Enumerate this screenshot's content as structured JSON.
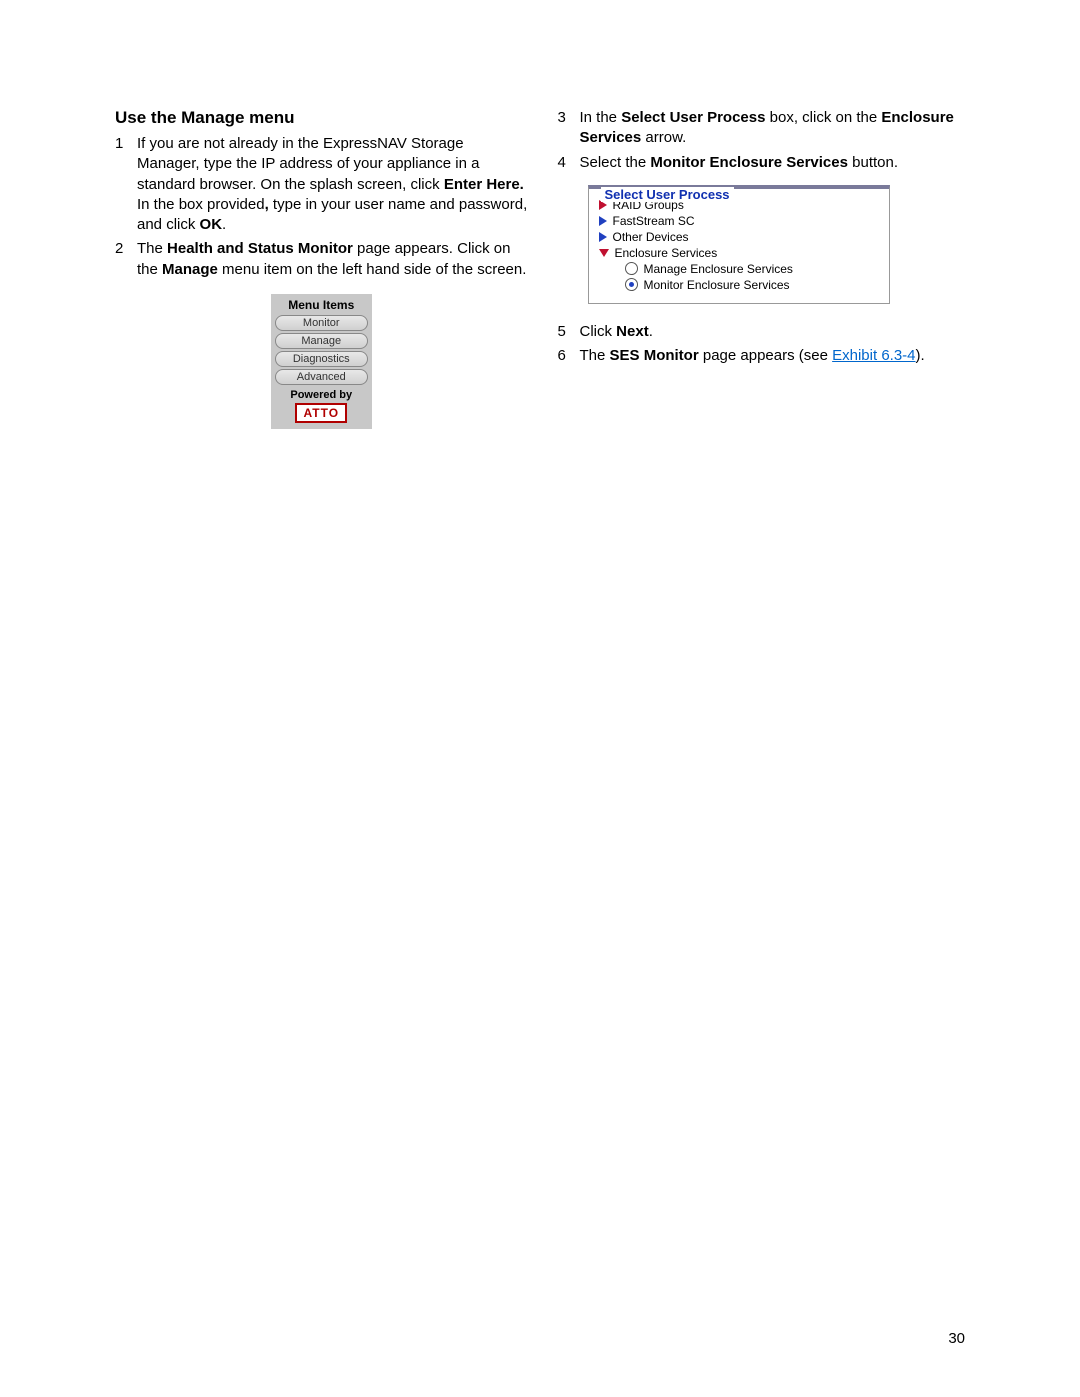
{
  "heading": "Use the Manage menu",
  "left_steps": {
    "s1": {
      "num": "1",
      "pre": "If you are not already in the ExpressNAV Storage Manager, type the IP address of your appliance in a standard browser. On the splash screen, click ",
      "b1": "Enter Here.",
      "mid": " In the box provided",
      "comma": ",",
      "post": " type in your user name and password, and click ",
      "b2": "OK",
      "end": "."
    },
    "s2": {
      "num": "2",
      "pre": "The ",
      "b1": "Health and Status Monitor",
      "mid": " page appears. Click on the ",
      "b2": "Manage",
      "post": " menu item on the left hand side of the screen."
    }
  },
  "menu_items_figure": {
    "header": "Menu Items",
    "items": [
      "Monitor",
      "Manage",
      "Diagnostics",
      "Advanced"
    ],
    "powered": "Powered by",
    "logo": "ATTO"
  },
  "right_steps": {
    "s3": {
      "num": "3",
      "pre": "In the ",
      "b1": "Select User Process",
      "mid": " box, click on the ",
      "b2": "Enclosure Services",
      "post": " arrow."
    },
    "s4": {
      "num": "4",
      "pre": "Select the ",
      "b1": "Monitor Enclosure Services",
      "post": " button."
    },
    "s5": {
      "num": "5",
      "pre": "Click ",
      "b1": "Next",
      "post": "."
    },
    "s6": {
      "num": "6",
      "pre": "The ",
      "b1": "SES Monitor",
      "mid": " page appears (see ",
      "link": "Exhibit 6.3-4",
      "post": ")."
    }
  },
  "sup_figure": {
    "legend": "Select User Process",
    "items": {
      "raid": "RAID Groups",
      "fast": "FastStream SC",
      "other": "Other Devices",
      "enc": "Enclosure Services",
      "manage": "Manage Enclosure Services",
      "monitor": "Monitor Enclosure Services"
    }
  },
  "page_number": "30"
}
